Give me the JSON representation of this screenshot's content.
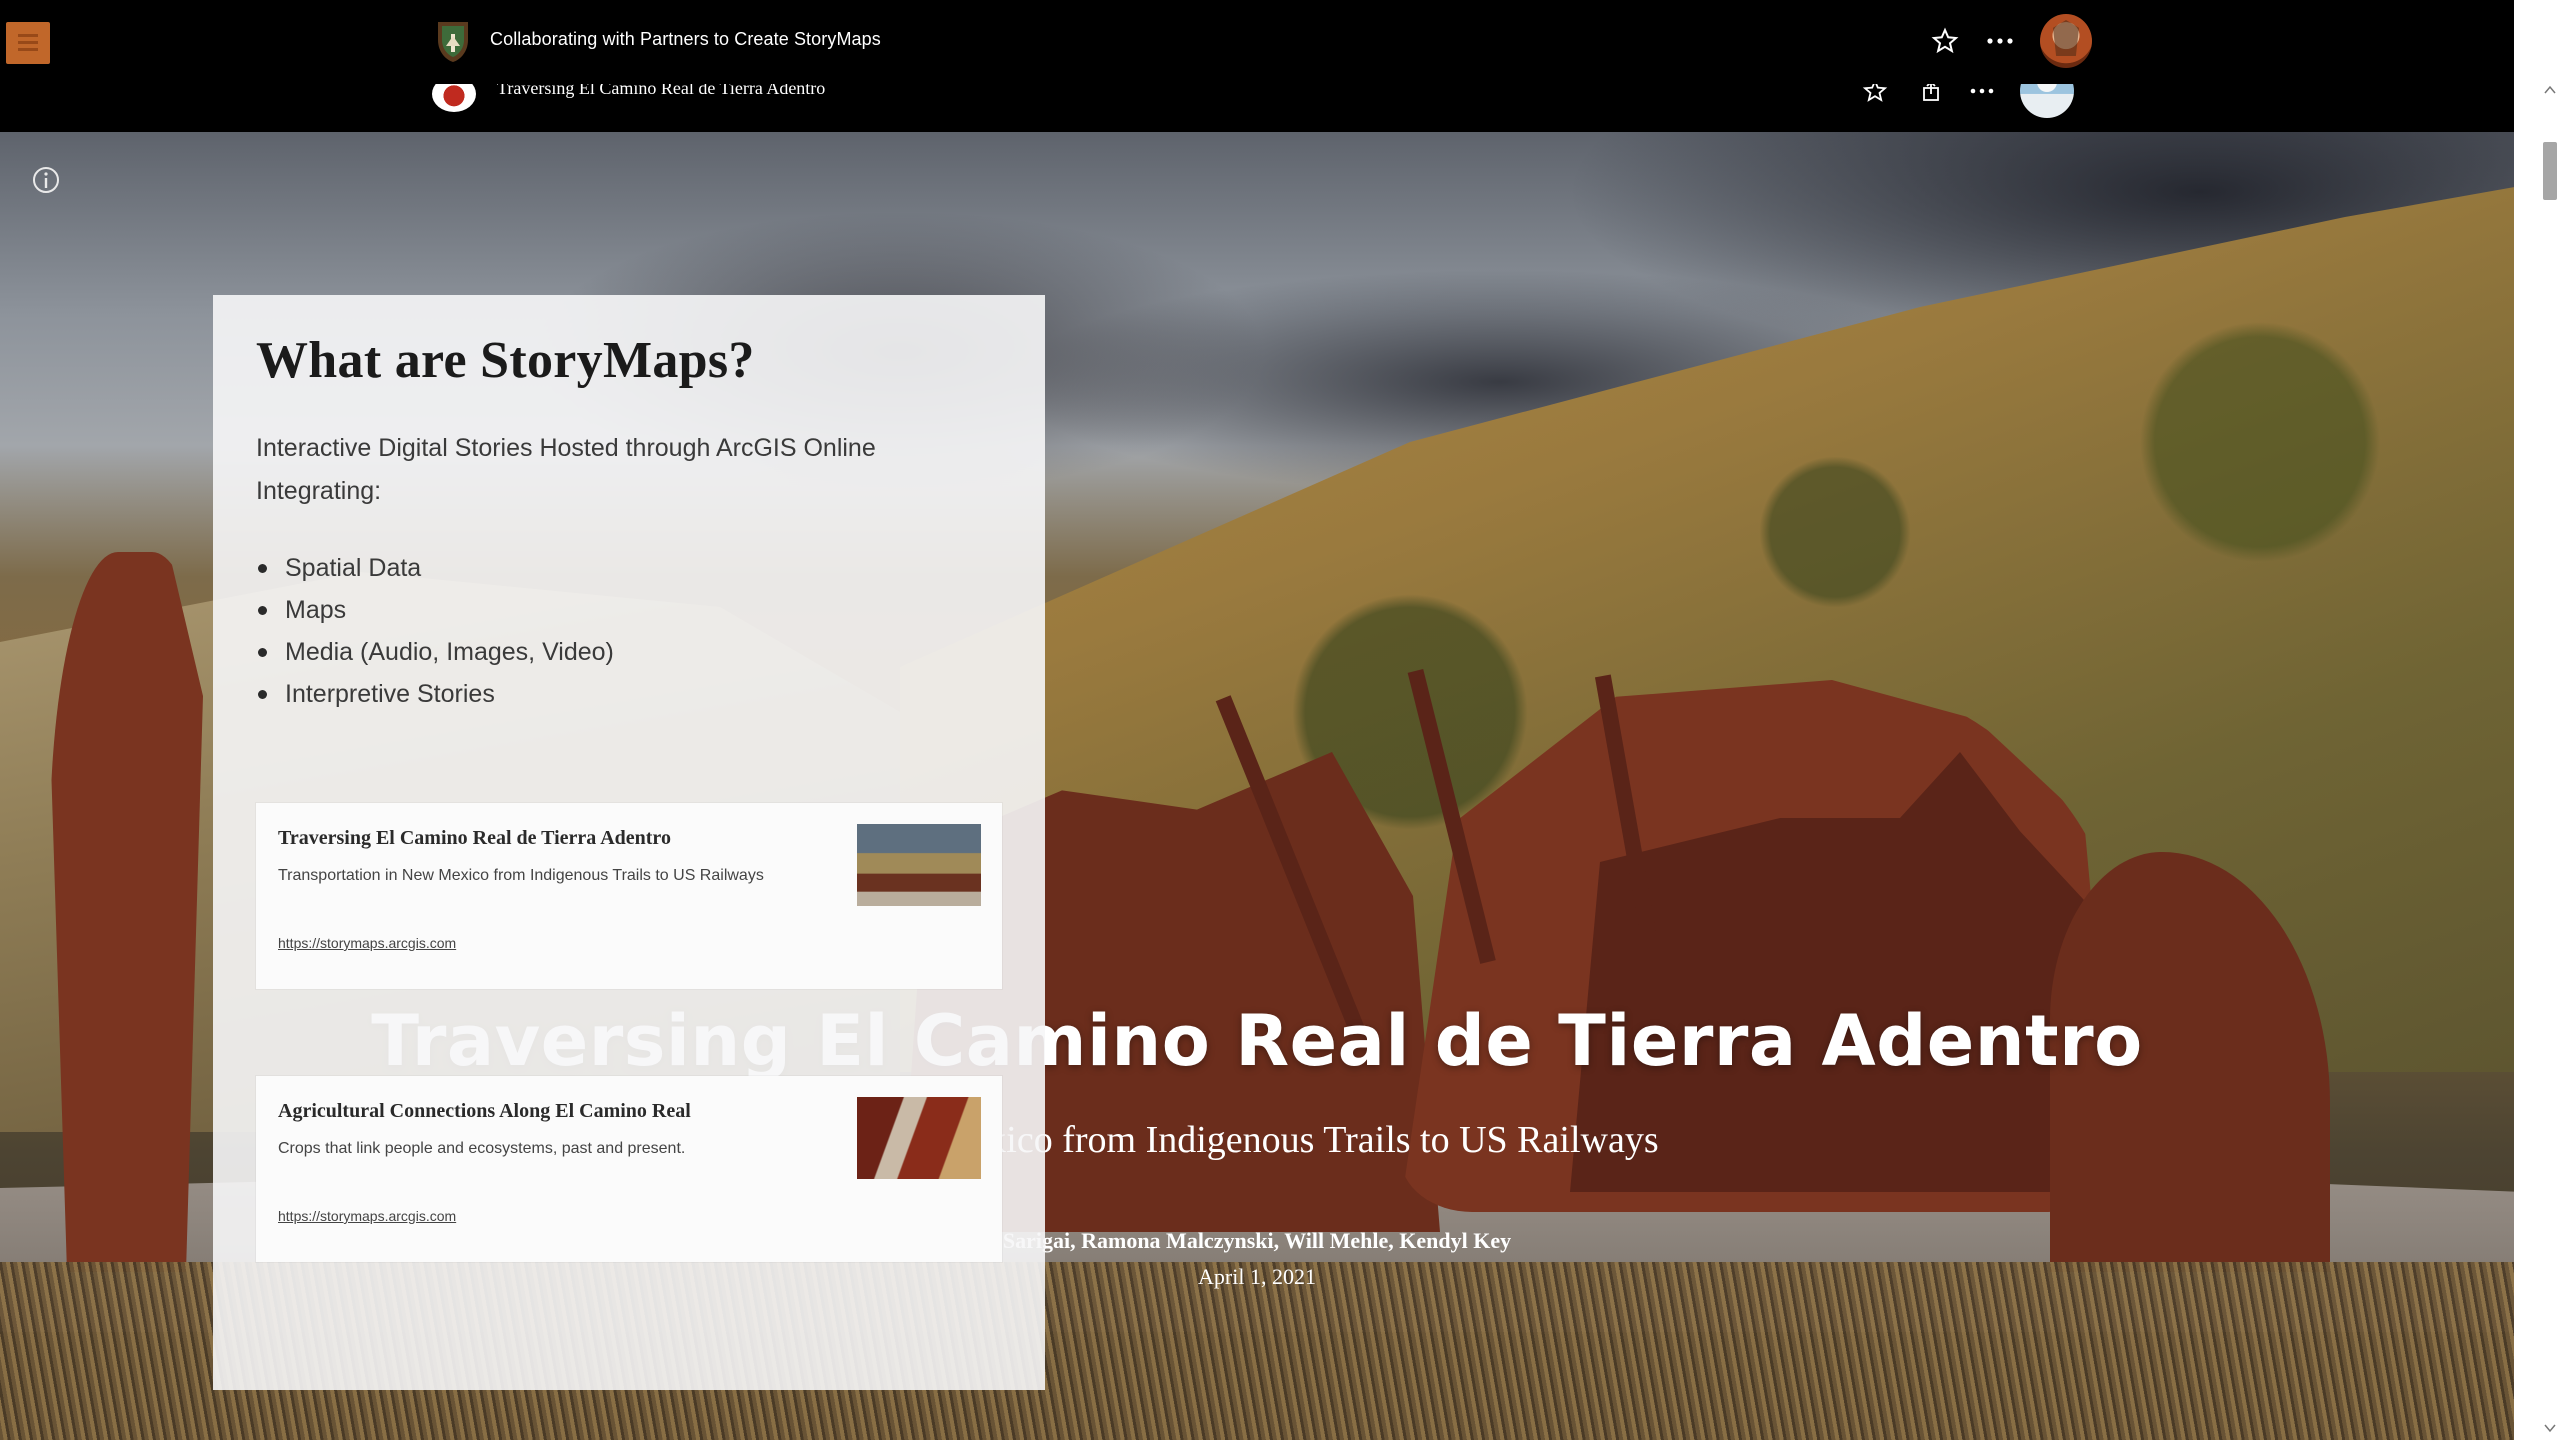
{
  "app_header": {
    "title": "Collaborating with Partners to Create StoryMaps"
  },
  "story_header": {
    "title": "Traversing El Camino Real de Tierra Adentro"
  },
  "cover": {
    "title": "Traversing El Camino Real de Tierra Adentro",
    "subtitle": "New Mexico from Indigenous Trails to US Railways",
    "authors": "Sarigai, Ramona Malczynski, Will Mehle, Kendyl Key",
    "date": "April 1, 2021"
  },
  "panel": {
    "heading": "What are StoryMaps?",
    "lead": "Interactive Digital Stories Hosted through ArcGIS Online Integrating:",
    "bullets": [
      "Spatial Data",
      "Maps",
      "Media (Audio, Images, Video)",
      "Interpretive Stories"
    ],
    "cards": [
      {
        "title": "Traversing El Camino Real de Tierra Adentro",
        "description": "Transportation in New Mexico from Indigenous Trails to US Railways",
        "link": "https://storymaps.arcgis.com"
      },
      {
        "title": "Agricultural Connections Along El Camino Real",
        "description": "Crops that link people and ecosystems, past and present.",
        "link": "https://storymaps.arcgis.com"
      }
    ]
  },
  "icons": {
    "menu": "hamburger-menu-icon",
    "nps": "nps-arrowhead-icon",
    "favorite": "star-icon",
    "more": "more-options-icon",
    "share": "share-icon",
    "info": "info-icon"
  },
  "colors": {
    "header_bg": "#000000",
    "menu_accent": "#c1672a",
    "panel_bg": "#f6f6f7",
    "cover_text": "#ffffff"
  }
}
